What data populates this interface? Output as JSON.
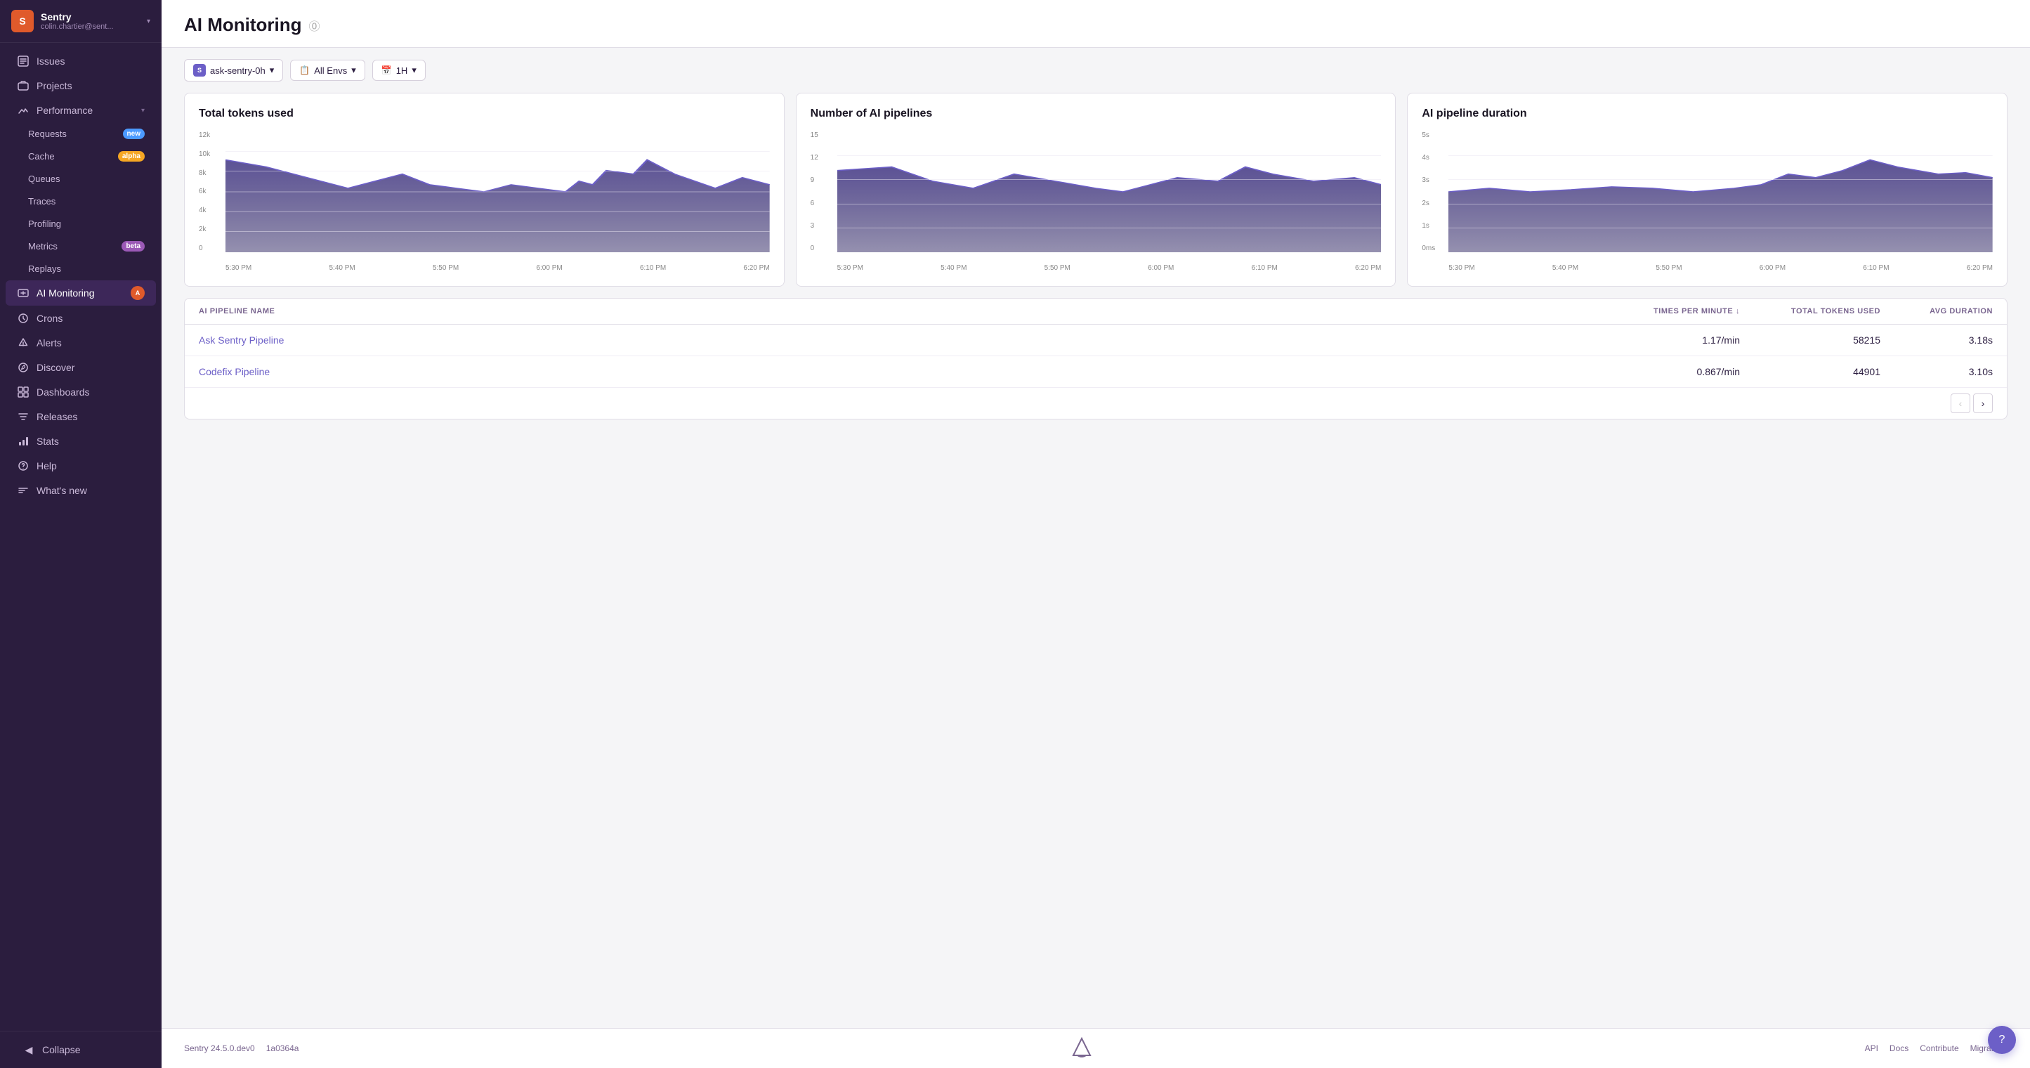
{
  "sidebar": {
    "org": {
      "initial": "S",
      "name": "Sentry",
      "email": "colin.chartier@sent..."
    },
    "nav": {
      "issues_label": "Issues",
      "projects_label": "Projects",
      "performance_label": "Performance",
      "requests_label": "Requests",
      "requests_badge": "new",
      "cache_label": "Cache",
      "cache_badge": "alpha",
      "queues_label": "Queues",
      "traces_label": "Traces",
      "profiling_label": "Profiling",
      "metrics_label": "Metrics",
      "metrics_badge": "beta",
      "replays_label": "Replays",
      "ai_monitoring_label": "AI Monitoring",
      "crons_label": "Crons",
      "alerts_label": "Alerts",
      "discover_label": "Discover",
      "dashboards_label": "Dashboards",
      "releases_label": "Releases",
      "stats_label": "Stats",
      "help_label": "Help",
      "whats_new_label": "What's new",
      "collapse_label": "Collapse"
    }
  },
  "toolbar": {
    "project_label": "ask-sentry-0h",
    "env_label": "All Envs",
    "time_label": "1H"
  },
  "page": {
    "title": "AI Monitoring",
    "help_icon": "?"
  },
  "charts": [
    {
      "id": "total-tokens",
      "title": "Total tokens used",
      "y_labels": [
        "12k",
        "10k",
        "8k",
        "6k",
        "4k",
        "2k",
        "0"
      ],
      "x_labels": [
        "5:30 PM",
        "5:40 PM",
        "5:50 PM",
        "6:00 PM",
        "6:10 PM",
        "6:20 PM"
      ],
      "color": "#3d3266"
    },
    {
      "id": "num-pipelines",
      "title": "Number of AI pipelines",
      "y_labels": [
        "15",
        "12",
        "9",
        "6",
        "3",
        "0"
      ],
      "x_labels": [
        "5:30 PM",
        "5:40 PM",
        "5:50 PM",
        "6:00 PM",
        "6:10 PM",
        "6:20 PM"
      ],
      "color": "#3d3266"
    },
    {
      "id": "pipeline-duration",
      "title": "AI pipeline duration",
      "y_labels": [
        "5s",
        "4s",
        "3s",
        "2s",
        "1s",
        "0ms"
      ],
      "x_labels": [
        "5:30 PM",
        "5:40 PM",
        "5:50 PM",
        "6:00 PM",
        "6:10 PM",
        "6:20 PM"
      ],
      "color": "#3d3266"
    }
  ],
  "table": {
    "headers": {
      "name": "AI PIPELINE NAME",
      "times": "TIMES PER MINUTE",
      "tokens": "TOTAL TOKENS USED",
      "duration": "AVG DURATION"
    },
    "sort_icon": "↓",
    "rows": [
      {
        "name": "Ask Sentry Pipeline",
        "times": "1.17/min",
        "tokens": "58215",
        "duration": "3.18s"
      },
      {
        "name": "Codefix Pipeline",
        "times": "0.867/min",
        "tokens": "44901",
        "duration": "3.10s"
      }
    ]
  },
  "footer": {
    "version": "Sentry 24.5.0.dev0",
    "commit": "1a0364a",
    "links": [
      "API",
      "Docs",
      "Contribute",
      "Migrate to"
    ]
  }
}
